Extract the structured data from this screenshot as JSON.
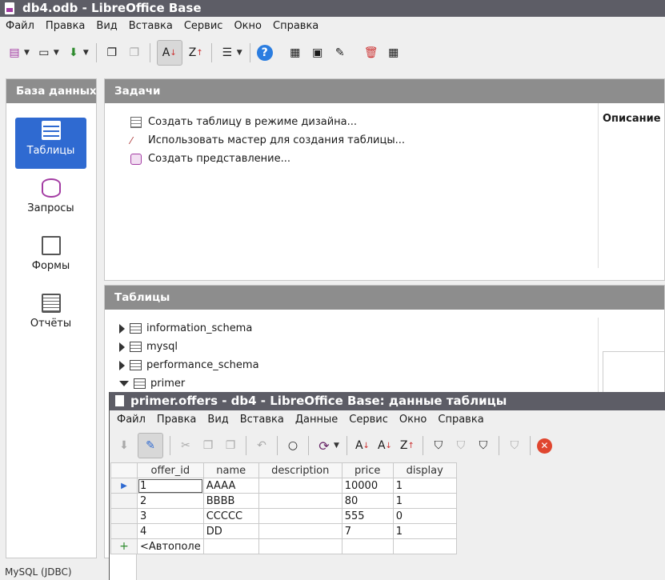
{
  "app": {
    "title": "db4.odb - LibreOffice Base",
    "menu": [
      "Файл",
      "Правка",
      "Вид",
      "Вставка",
      "Сервис",
      "Окно",
      "Справка"
    ],
    "status": "MySQL (JDBC)"
  },
  "sidebar": {
    "header": "База данных",
    "items": [
      {
        "label": "Таблицы",
        "selected": true,
        "icon": "table-icon"
      },
      {
        "label": "Запросы",
        "selected": false,
        "icon": "database-icon"
      },
      {
        "label": "Формы",
        "selected": false,
        "icon": "form-icon"
      },
      {
        "label": "Отчёты",
        "selected": false,
        "icon": "report-icon"
      }
    ]
  },
  "tasks": {
    "header": "Задачи",
    "description_label": "Описание",
    "items": [
      "Создать таблицу в режиме дизайна...",
      "Использовать мастер для создания таблицы...",
      "Создать представление..."
    ]
  },
  "tables": {
    "header": "Таблицы",
    "tree": [
      "information_schema",
      "mysql",
      "performance_schema",
      "primer"
    ]
  },
  "datawin": {
    "title": "primer.offers - db4 - LibreOffice Base: данные таблицы",
    "menu": [
      "Файл",
      "Правка",
      "Вид",
      "Вставка",
      "Данные",
      "Сервис",
      "Окно",
      "Справка"
    ],
    "columns": [
      "offer_id",
      "name",
      "description",
      "price",
      "display"
    ],
    "rows": [
      [
        "1",
        "AAAA",
        "",
        "10000",
        "1"
      ],
      [
        "2",
        "BBBB",
        "",
        "80",
        "1"
      ],
      [
        "3",
        "CCCCC",
        "",
        "555",
        "0"
      ],
      [
        "4",
        "DD",
        "",
        "7",
        "1"
      ]
    ],
    "new_row": "<Автополе"
  },
  "colors": {
    "selection": "#2f6ad1",
    "titlebar": "#5d5d66",
    "panel_header": "#8d8d8d"
  }
}
